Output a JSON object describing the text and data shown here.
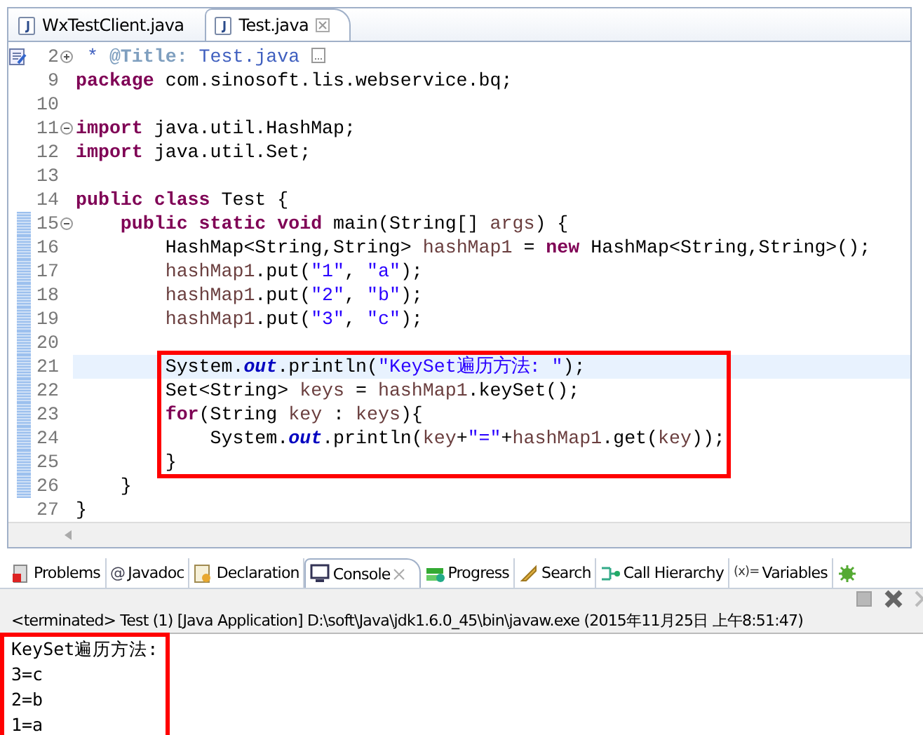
{
  "editor": {
    "tabs": [
      {
        "label": "WxTestClient.java",
        "selected": false
      },
      {
        "label": "Test.java",
        "selected": true
      }
    ],
    "lines": [
      {
        "number": "2",
        "folding": {
          "collapsed": true
        },
        "javadoc_marker": true,
        "diff": false,
        "current": false,
        "boxed": false,
        "tokens": [
          {
            "text": " * ",
            "kind": "doc"
          },
          {
            "text": "@Title:",
            "kind": "doctag"
          },
          {
            "text": " Test.java ",
            "kind": "doc"
          }
        ]
      },
      {
        "number": "9",
        "diff": false,
        "current": false,
        "boxed": false,
        "tokens": [
          {
            "text": "package",
            "kind": "kw"
          },
          {
            "text": " com.sinosoft.lis.webservice.bq;",
            "kind": "plain"
          }
        ]
      },
      {
        "number": "10",
        "diff": false,
        "current": false,
        "boxed": false
      },
      {
        "number": "11",
        "folding": {
          "collapsed": false
        },
        "diff": false,
        "current": false,
        "boxed": false,
        "tokens": [
          {
            "text": "import",
            "kind": "kw"
          },
          {
            "text": " java.util.HashMap;",
            "kind": "plain"
          }
        ]
      },
      {
        "number": "12",
        "diff": false,
        "current": false,
        "boxed": false,
        "tokens": [
          {
            "text": "import",
            "kind": "kw"
          },
          {
            "text": " java.util.Set;",
            "kind": "plain"
          }
        ]
      },
      {
        "number": "13",
        "diff": false,
        "current": false,
        "boxed": false
      },
      {
        "number": "14",
        "diff": false,
        "current": false,
        "boxed": false,
        "tokens": [
          {
            "text": "public class",
            "kind": "kw"
          },
          {
            "text": " Test {",
            "kind": "plain"
          }
        ]
      },
      {
        "number": "15",
        "folding": {
          "collapsed": false
        },
        "diff": true,
        "current": false,
        "boxed": false,
        "tokens": [
          {
            "text": "    public static void",
            "kind": "kw"
          },
          {
            "text": " main(String[] ",
            "kind": "plain"
          },
          {
            "text": "args",
            "kind": "local"
          },
          {
            "text": ") {",
            "kind": "plain"
          }
        ]
      },
      {
        "number": "16",
        "diff": true,
        "current": false,
        "boxed": false,
        "tokens": [
          {
            "text": "        HashMap<String,String> ",
            "kind": "plain"
          },
          {
            "text": "hashMap1",
            "kind": "local"
          },
          {
            "text": " = ",
            "kind": "plain"
          },
          {
            "text": "new",
            "kind": "kw"
          },
          {
            "text": " HashMap<String,String>();",
            "kind": "plain"
          }
        ]
      },
      {
        "number": "17",
        "diff": true,
        "current": false,
        "boxed": false,
        "tokens": [
          {
            "text": "        hashMap1",
            "kind": "local"
          },
          {
            "text": ".put(",
            "kind": "plain"
          },
          {
            "text": "\"1\"",
            "kind": "str"
          },
          {
            "text": ", ",
            "kind": "plain"
          },
          {
            "text": "\"a\"",
            "kind": "str"
          },
          {
            "text": ");",
            "kind": "plain"
          }
        ]
      },
      {
        "number": "18",
        "diff": true,
        "current": false,
        "boxed": false,
        "tokens": [
          {
            "text": "        hashMap1",
            "kind": "local"
          },
          {
            "text": ".put(",
            "kind": "plain"
          },
          {
            "text": "\"2\"",
            "kind": "str"
          },
          {
            "text": ", ",
            "kind": "plain"
          },
          {
            "text": "\"b\"",
            "kind": "str"
          },
          {
            "text": ");",
            "kind": "plain"
          }
        ]
      },
      {
        "number": "19",
        "diff": true,
        "current": false,
        "boxed": false,
        "tokens": [
          {
            "text": "        hashMap1",
            "kind": "local"
          },
          {
            "text": ".put(",
            "kind": "plain"
          },
          {
            "text": "\"3\"",
            "kind": "str"
          },
          {
            "text": ", ",
            "kind": "plain"
          },
          {
            "text": "\"c\"",
            "kind": "str"
          },
          {
            "text": ");",
            "kind": "plain"
          }
        ]
      },
      {
        "number": "20",
        "diff": true,
        "current": false,
        "boxed": false
      },
      {
        "number": "21",
        "diff": true,
        "current": true,
        "boxed": true,
        "tokens": [
          {
            "text": "        System.",
            "kind": "plain"
          },
          {
            "text": "out",
            "kind": "field"
          },
          {
            "text": ".println(",
            "kind": "plain"
          },
          {
            "text": "\"KeySet遍历方法: \"",
            "kind": "str"
          },
          {
            "text": ");",
            "kind": "plain"
          }
        ]
      },
      {
        "number": "22",
        "diff": true,
        "current": false,
        "boxed": true,
        "tokens": [
          {
            "text": "        Set<String> ",
            "kind": "plain"
          },
          {
            "text": "keys",
            "kind": "local"
          },
          {
            "text": " = ",
            "kind": "plain"
          },
          {
            "text": "hashMap1",
            "kind": "local"
          },
          {
            "text": ".keySet();",
            "kind": "plain"
          }
        ]
      },
      {
        "number": "23",
        "diff": true,
        "current": false,
        "boxed": true,
        "tokens": [
          {
            "text": "        for",
            "kind": "kw"
          },
          {
            "text": "(String ",
            "kind": "plain"
          },
          {
            "text": "key",
            "kind": "local"
          },
          {
            "text": " : ",
            "kind": "plain"
          },
          {
            "text": "keys",
            "kind": "local"
          },
          {
            "text": "){",
            "kind": "plain"
          }
        ]
      },
      {
        "number": "24",
        "diff": true,
        "current": false,
        "boxed": true,
        "tokens": [
          {
            "text": "            System.",
            "kind": "plain"
          },
          {
            "text": "out",
            "kind": "field"
          },
          {
            "text": ".println(",
            "kind": "plain"
          },
          {
            "text": "key",
            "kind": "local"
          },
          {
            "text": "+",
            "kind": "plain"
          },
          {
            "text": "\"=\"",
            "kind": "str"
          },
          {
            "text": "+",
            "kind": "plain"
          },
          {
            "text": "hashMap1",
            "kind": "local"
          },
          {
            "text": ".get(",
            "kind": "plain"
          },
          {
            "text": "key",
            "kind": "local"
          },
          {
            "text": "));",
            "kind": "plain"
          }
        ]
      },
      {
        "number": "25",
        "diff": true,
        "current": false,
        "boxed": true,
        "tokens": [
          {
            "text": "        }",
            "kind": "plain"
          }
        ]
      },
      {
        "number": "26",
        "diff": true,
        "current": false,
        "boxed": false,
        "tokens": [
          {
            "text": "    }",
            "kind": "plain"
          }
        ]
      },
      {
        "number": "27",
        "diff": false,
        "current": false,
        "boxed": false,
        "tokens": [
          {
            "text": "}",
            "kind": "plain"
          }
        ]
      }
    ]
  },
  "panel": {
    "tabs": [
      {
        "label": "Problems",
        "kind": "problems",
        "selected": false
      },
      {
        "label": "Javadoc",
        "kind": "javadoc",
        "glyph": "@",
        "selected": false
      },
      {
        "label": "Declaration",
        "kind": "declaration",
        "selected": false
      },
      {
        "label": "Console",
        "kind": "console",
        "selected": true
      },
      {
        "label": "Progress",
        "kind": "progress",
        "selected": false
      },
      {
        "label": "Search",
        "kind": "search",
        "selected": false
      },
      {
        "label": "Call Hierarchy",
        "kind": "hierarchy",
        "selected": false
      },
      {
        "label": "Variables",
        "kind": "variables",
        "glyph": "(x)=",
        "selected": false
      },
      {
        "kind": "debug",
        "selected": false
      }
    ],
    "status": "<terminated> Test (1) [Java Application] D:\\soft\\Java\\jdk1.6.0_45\\bin\\javaw.exe (2015年11月25日 上午8:51:47)",
    "output": [
      {
        "text": "KeySet遍历方法:",
        "boxed": true
      },
      {
        "text": "3=c",
        "boxed": true
      },
      {
        "text": "2=b",
        "boxed": true
      },
      {
        "text": "1=a",
        "boxed": true
      }
    ]
  }
}
